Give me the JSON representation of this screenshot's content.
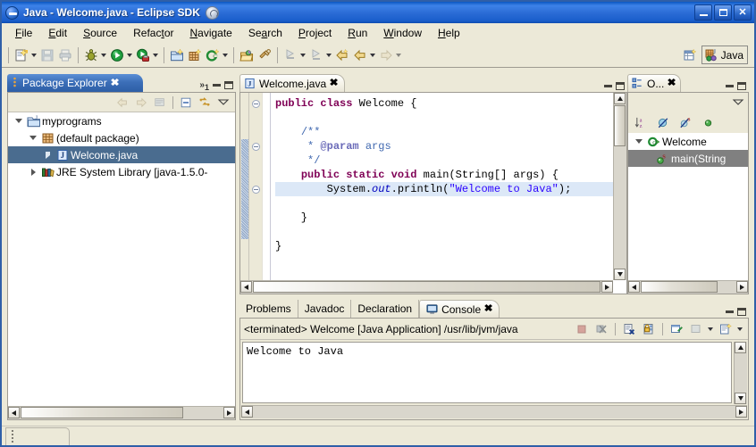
{
  "window": {
    "title": "Java - Welcome.java - Eclipse SDK",
    "minimize_label": "",
    "maximize_label": "",
    "close_label": "✕"
  },
  "menubar": {
    "items": [
      {
        "label": "File",
        "mnemonic": "F"
      },
      {
        "label": "Edit",
        "mnemonic": "E"
      },
      {
        "label": "Source",
        "mnemonic": "S"
      },
      {
        "label": "Refactor",
        "mnemonic": "t"
      },
      {
        "label": "Navigate",
        "mnemonic": "N"
      },
      {
        "label": "Search",
        "mnemonic": "a"
      },
      {
        "label": "Project",
        "mnemonic": "P"
      },
      {
        "label": "Run",
        "mnemonic": "R"
      },
      {
        "label": "Window",
        "mnemonic": "W"
      },
      {
        "label": "Help",
        "mnemonic": "H"
      }
    ]
  },
  "toolbar": {
    "icons": [
      "new-wizard-icon",
      "save-icon",
      "print-icon",
      "debug-icon",
      "run-icon",
      "run-external-tools-icon",
      "new-java-project-icon",
      "new-package-icon",
      "new-class-icon",
      "open-type-icon",
      "search-icon",
      "next-annotation-icon",
      "previous-annotation-icon",
      "last-edit-location-icon",
      "back-icon",
      "forward-icon"
    ],
    "perspective": {
      "open_perspective_label": "open-perspective-icon",
      "current_label": "Java"
    }
  },
  "package_explorer": {
    "tab_label": "Package Explorer",
    "close_label": "✖",
    "chevron_label": "»",
    "chevron_count": "1",
    "toolbar_icons": [
      "back-icon",
      "forward-icon",
      "collapse-link-icon",
      "collapse-all-icon",
      "link-with-editor-icon",
      "view-menu-icon"
    ],
    "tree": [
      {
        "label": "myprograms",
        "indent": 0,
        "state": "expanded",
        "icon": "java-project-icon",
        "selected": false
      },
      {
        "label": "(default package)",
        "indent": 1,
        "state": "expanded",
        "icon": "package-icon",
        "selected": false
      },
      {
        "label": "Welcome.java",
        "indent": 2,
        "state": "collapsed",
        "icon": "java-file-icon",
        "selected": true
      },
      {
        "label": "JRE System Library [java-1.5.0-",
        "indent": 1,
        "state": "collapsed",
        "icon": "library-icon",
        "selected": false
      }
    ]
  },
  "editor": {
    "tab_label": "Welcome.java",
    "tab_icon": "java-file-icon",
    "close_label": "✖",
    "minimize_label": "",
    "maximize_label": "",
    "code_lines": [
      {
        "text": "public class Welcome {",
        "fold": true
      },
      {
        "text": "",
        "fold": false
      },
      {
        "text": "    /**",
        "fold": true
      },
      {
        "text": "     * @param args",
        "fold": false
      },
      {
        "text": "     */",
        "fold": false
      },
      {
        "text": "    public static void main(String[] args) {",
        "fold": true
      },
      {
        "text": "        System.out.println(\"Welcome to Java\");",
        "fold": false,
        "highlight": true
      },
      {
        "text": "    }",
        "fold": false
      },
      {
        "text": "",
        "fold": false
      },
      {
        "text": "}",
        "fold": false
      }
    ]
  },
  "outline": {
    "tab_label": "O...",
    "tab_icon": "outline-icon",
    "close_label": "✖",
    "toolbar_icons": [
      "sort-icon",
      "hide-fields-icon",
      "hide-static-icon",
      "hide-non-public-icon",
      "view-menu-icon"
    ],
    "tree": [
      {
        "label": "Welcome",
        "indent": 0,
        "state": "expanded",
        "icon": "class-icon",
        "selected": false
      },
      {
        "label": "main(String",
        "indent": 1,
        "state": "leaf",
        "icon": "method-static-icon",
        "selected": true
      }
    ]
  },
  "console": {
    "tabs": [
      {
        "label": "Problems",
        "active": false,
        "icon": ""
      },
      {
        "label": "Javadoc",
        "active": false,
        "icon": ""
      },
      {
        "label": "Declaration",
        "active": false,
        "icon": ""
      },
      {
        "label": "Console",
        "active": true,
        "icon": "console-icon"
      }
    ],
    "close_label": "✖",
    "header_text": "<terminated> Welcome [Java Application] /usr/lib/jvm/java",
    "toolbar_icons": [
      "terminate-icon",
      "remove-all-terminated-icon",
      "clear-console-icon",
      "scroll-lock-icon",
      "pin-console-icon",
      "display-selected-console-icon",
      "open-console-icon"
    ],
    "output": "Welcome to Java"
  },
  "statusbar": {
    "text": ""
  },
  "colors": {
    "title_bar": "#2b6cd6",
    "selection": "#4a6c8f",
    "outline_selection": "#808080",
    "keyword": "#7f0055",
    "comment": "#4169b0",
    "string": "#2a00ff",
    "chrome": "#ece9d8",
    "highlight_line": "#dce8f7"
  }
}
